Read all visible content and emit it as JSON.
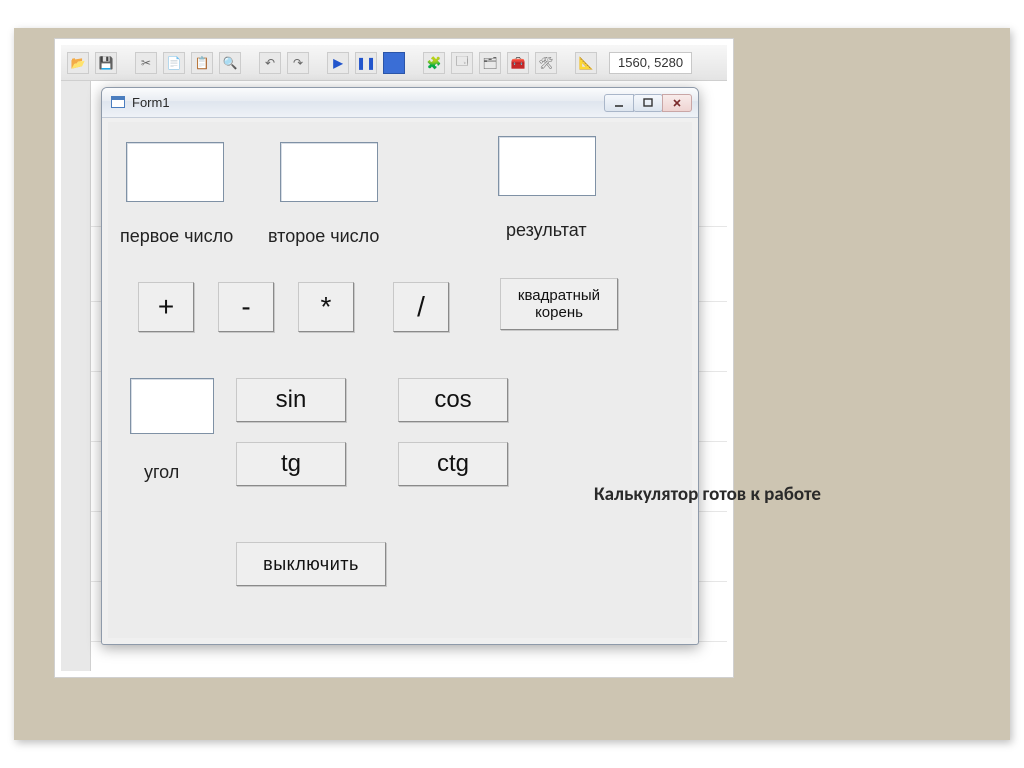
{
  "slide_caption": "Калькулятор готов к работе",
  "ide": {
    "cursor_coords": "1560, 5280"
  },
  "window": {
    "title": "Form1"
  },
  "labels": {
    "first_number": "первое число",
    "second_number": "второе число",
    "result": "результат",
    "angle": "угол"
  },
  "inputs": {
    "first_number": "",
    "second_number": "",
    "result": "",
    "angle": ""
  },
  "buttons": {
    "plus": "+",
    "minus": "-",
    "multiply": "*",
    "divide": "/",
    "sqrt": "квадратный\nкорень",
    "sin": "sin",
    "cos": "cos",
    "tg": "tg",
    "ctg": "ctg",
    "off": "выключить"
  }
}
